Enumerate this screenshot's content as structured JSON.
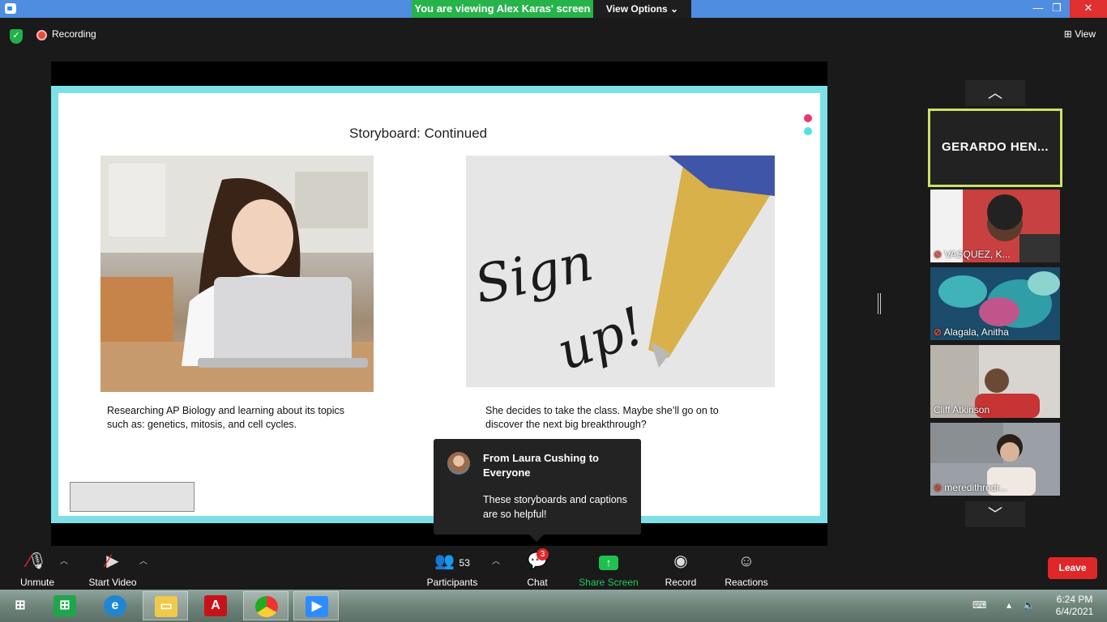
{
  "window": {
    "viewing_banner": "You are viewing Alex Karas' screen",
    "view_options_label": "View Options ⌄",
    "minimize": "—",
    "maximize": "❐",
    "close": "✕"
  },
  "topbar": {
    "recording_label": "Recording",
    "view_label": "View"
  },
  "slide": {
    "title": "Storyboard: Continued",
    "caption_left": "Researching AP Biology and learning about its topics such as: genetics, mitosis, and cell cycles.",
    "caption_right": "She decides to take the class. Maybe she’ll go on to discover the next big breakthrough?",
    "sign_up_text_1": "Sign",
    "sign_up_text_2": "up!"
  },
  "chat_toast": {
    "from": "From Laura Cushing to Everyone",
    "message": "These storyboards and captions are so helpful!"
  },
  "gallery": {
    "active_speaker": "GERARDO  HEN...",
    "participants": [
      {
        "name": "VASQUEZ, K...",
        "muted": true
      },
      {
        "name": "Alagala, Anitha",
        "muted": true
      },
      {
        "name": "Cliff Atkinson",
        "muted": false
      },
      {
        "name": "meredithrodr...",
        "muted": true
      }
    ]
  },
  "toolbar": {
    "unmute": "Unmute",
    "start_video": "Start Video",
    "participants": "Participants",
    "participants_count": "53",
    "chat": "Chat",
    "chat_badge": "3",
    "share_screen": "Share Screen",
    "record": "Record",
    "reactions": "Reactions",
    "leave": "Leave"
  },
  "taskbar": {
    "time": "6:24 PM",
    "date": "6/4/2021"
  },
  "colors": {
    "accent_green": "#21c95a",
    "leave_red": "#e02727",
    "slide_border": "#7de0e7",
    "active_speaker_border": "#c9e265"
  }
}
